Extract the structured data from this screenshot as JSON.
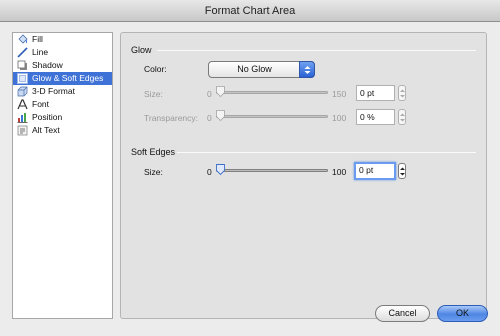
{
  "window": {
    "title": "Format Chart Area"
  },
  "sidebar": {
    "items": [
      {
        "label": "Fill",
        "icon": "paint-bucket-icon"
      },
      {
        "label": "Line",
        "icon": "line-icon"
      },
      {
        "label": "Shadow",
        "icon": "shadow-icon"
      },
      {
        "label": "Glow & Soft Edges",
        "icon": "glow-icon",
        "selected": true
      },
      {
        "label": "3-D Format",
        "icon": "3d-format-icon"
      },
      {
        "label": "Font",
        "icon": "font-icon"
      },
      {
        "label": "Position",
        "icon": "position-icon"
      },
      {
        "label": "Alt Text",
        "icon": "alt-text-icon"
      }
    ]
  },
  "glow": {
    "title": "Glow",
    "color_label": "Color:",
    "color_value": "No Glow",
    "size_label": "Size:",
    "size_min": "0",
    "size_max": "150",
    "size_value": "0 pt",
    "transparency_label": "Transparency:",
    "transparency_min": "0",
    "transparency_max": "100",
    "transparency_value": "0 %"
  },
  "soft_edges": {
    "title": "Soft Edges",
    "size_label": "Size:",
    "size_min": "0",
    "size_max": "100",
    "size_value": "0 pt"
  },
  "buttons": {
    "cancel": "Cancel",
    "ok": "OK"
  },
  "colors": {
    "accent": "#3f72d7",
    "panel": "#e2e2e2",
    "window": "#ececec"
  }
}
